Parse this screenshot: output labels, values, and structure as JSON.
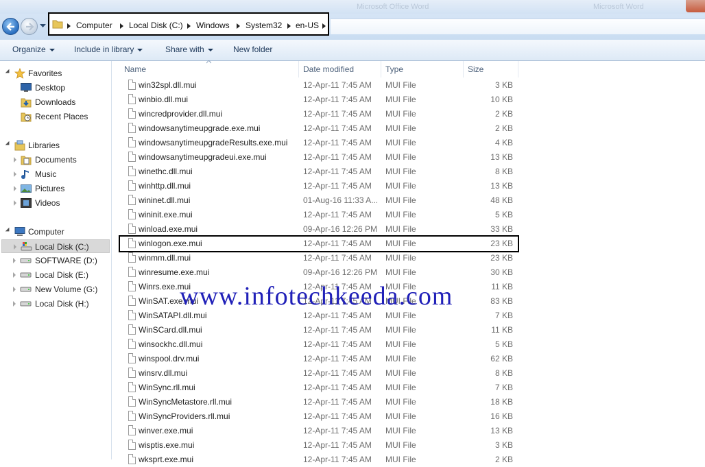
{
  "window": {
    "blurred_title": "Microsoft Office Word",
    "blurred_title2": "Microsoft Word"
  },
  "address_bar": {
    "crumbs": [
      "Computer",
      "Local Disk (C:)",
      "Windows",
      "System32",
      "en-US"
    ]
  },
  "command_bar": {
    "organize": "Organize",
    "include_in_library": "Include in library",
    "share_with": "Share with",
    "new_folder": "New folder"
  },
  "nav": {
    "favorites": {
      "label": "Favorites",
      "items": [
        "Desktop",
        "Downloads",
        "Recent Places"
      ]
    },
    "libraries": {
      "label": "Libraries",
      "items": [
        "Documents",
        "Music",
        "Pictures",
        "Videos"
      ]
    },
    "computer": {
      "label": "Computer",
      "items": [
        "Local Disk (C:)",
        "SOFTWARE (D:)",
        "Local Disk (E:)",
        "New Volume (G:)",
        "Local Disk (H:)"
      ],
      "selected": "Local Disk (C:)"
    }
  },
  "columns": {
    "name": "Name",
    "date": "Date modified",
    "type": "Type",
    "size": "Size"
  },
  "files": [
    {
      "name": "win32spl.dll.mui",
      "date": "12-Apr-11 7:45 AM",
      "type": "MUI File",
      "size": "3 KB"
    },
    {
      "name": "winbio.dll.mui",
      "date": "12-Apr-11 7:45 AM",
      "type": "MUI File",
      "size": "10 KB"
    },
    {
      "name": "wincredprovider.dll.mui",
      "date": "12-Apr-11 7:45 AM",
      "type": "MUI File",
      "size": "2 KB"
    },
    {
      "name": "windowsanytimeupgrade.exe.mui",
      "date": "12-Apr-11 7:45 AM",
      "type": "MUI File",
      "size": "2 KB"
    },
    {
      "name": "windowsanytimeupgradeResults.exe.mui",
      "date": "12-Apr-11 7:45 AM",
      "type": "MUI File",
      "size": "4 KB"
    },
    {
      "name": "windowsanytimeupgradeui.exe.mui",
      "date": "12-Apr-11 7:45 AM",
      "type": "MUI File",
      "size": "13 KB"
    },
    {
      "name": "winethc.dll.mui",
      "date": "12-Apr-11 7:45 AM",
      "type": "MUI File",
      "size": "8 KB"
    },
    {
      "name": "winhttp.dll.mui",
      "date": "12-Apr-11 7:45 AM",
      "type": "MUI File",
      "size": "13 KB"
    },
    {
      "name": "wininet.dll.mui",
      "date": "01-Aug-16 11:33 A...",
      "type": "MUI File",
      "size": "48 KB"
    },
    {
      "name": "wininit.exe.mui",
      "date": "12-Apr-11 7:45 AM",
      "type": "MUI File",
      "size": "5 KB"
    },
    {
      "name": "winload.exe.mui",
      "date": "09-Apr-16 12:26 PM",
      "type": "MUI File",
      "size": "33 KB"
    },
    {
      "name": "winlogon.exe.mui",
      "date": "12-Apr-11 7:45 AM",
      "type": "MUI File",
      "size": "23 KB"
    },
    {
      "name": "winmm.dll.mui",
      "date": "12-Apr-11 7:45 AM",
      "type": "MUI File",
      "size": "23 KB"
    },
    {
      "name": "winresume.exe.mui",
      "date": "09-Apr-16 12:26 PM",
      "type": "MUI File",
      "size": "30 KB"
    },
    {
      "name": "Winrs.exe.mui",
      "date": "12-Apr-11 7:45 AM",
      "type": "MUI File",
      "size": "11 KB"
    },
    {
      "name": "WinSAT.exe.mui",
      "date": "12-Apr-11 7:45 AM",
      "type": "MUI File",
      "size": "83 KB"
    },
    {
      "name": "WinSATAPI.dll.mui",
      "date": "12-Apr-11 7:45 AM",
      "type": "MUI File",
      "size": "7 KB"
    },
    {
      "name": "WinSCard.dll.mui",
      "date": "12-Apr-11 7:45 AM",
      "type": "MUI File",
      "size": "11 KB"
    },
    {
      "name": "winsockhc.dll.mui",
      "date": "12-Apr-11 7:45 AM",
      "type": "MUI File",
      "size": "5 KB"
    },
    {
      "name": "winspool.drv.mui",
      "date": "12-Apr-11 7:45 AM",
      "type": "MUI File",
      "size": "62 KB"
    },
    {
      "name": "winsrv.dll.mui",
      "date": "12-Apr-11 7:45 AM",
      "type": "MUI File",
      "size": "8 KB"
    },
    {
      "name": "WinSync.rll.mui",
      "date": "12-Apr-11 7:45 AM",
      "type": "MUI File",
      "size": "7 KB"
    },
    {
      "name": "WinSyncMetastore.rll.mui",
      "date": "12-Apr-11 7:45 AM",
      "type": "MUI File",
      "size": "18 KB"
    },
    {
      "name": "WinSyncProviders.rll.mui",
      "date": "12-Apr-11 7:45 AM",
      "type": "MUI File",
      "size": "16 KB"
    },
    {
      "name": "winver.exe.mui",
      "date": "12-Apr-11 7:45 AM",
      "type": "MUI File",
      "size": "13 KB"
    },
    {
      "name": "wisptis.exe.mui",
      "date": "12-Apr-11 7:45 AM",
      "type": "MUI File",
      "size": "3 KB"
    },
    {
      "name": "wksprt.exe.mui",
      "date": "12-Apr-11 7:45 AM",
      "type": "MUI File",
      "size": "2 KB"
    }
  ],
  "highlighted_file": "winlogon.exe.mui",
  "watermark": "www.infotechkeeda.com"
}
